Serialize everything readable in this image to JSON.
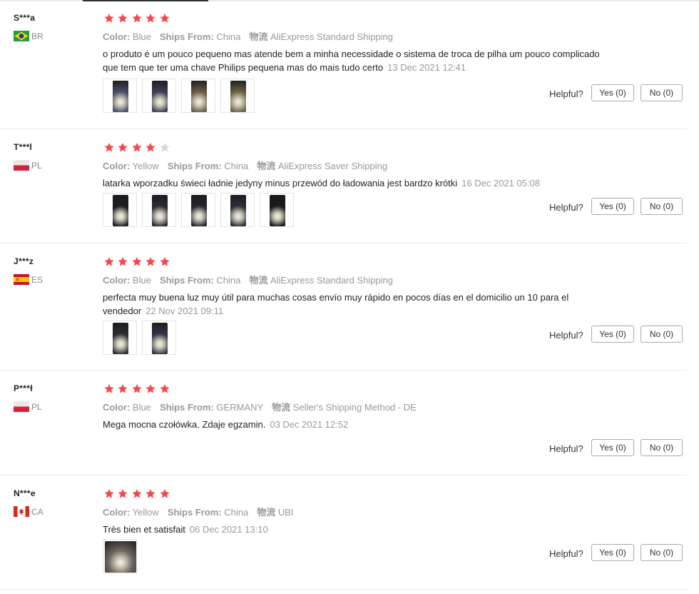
{
  "labels": {
    "color": "Color:",
    "ships_from": "Ships From:",
    "logistics": "物流",
    "helpful": "Helpful?"
  },
  "colors": {
    "star_filled": "#f5474c",
    "star_empty": "#d6d6d6",
    "label_gray": "#999999"
  },
  "reviews": [
    {
      "user": "S***a",
      "country": "BR",
      "flag_icon": "brazil-flag-icon",
      "rating": 5,
      "color": "Blue",
      "ships_from": "China",
      "shipping": "AliExpress Standard Shipping",
      "text": "o produto é um pouco pequeno mas atende bem a minha necessidade o sistema de troca de pilha um pouco complicado que tem que ter uma chave Philips pequena mas do mais tudo certo",
      "date": "13 Dec 2021 12:41",
      "photos": 4,
      "yes": "Yes (0)",
      "no": "No (0)"
    },
    {
      "user": "T***l",
      "country": "PL",
      "flag_icon": "poland-flag-icon",
      "rating": 4,
      "color": "Yellow",
      "ships_from": "China",
      "shipping": "AliExpress Saver Shipping",
      "text": "latarka wporzadku świeci ładnie jedyny minus przewód do ładowania jest bardzo krótki",
      "date": "16 Dec 2021 05:08",
      "photos": 5,
      "yes": "Yes (0)",
      "no": "No (0)"
    },
    {
      "user": "J***z",
      "country": "ES",
      "flag_icon": "spain-flag-icon",
      "rating": 5,
      "color": "Blue",
      "ships_from": "China",
      "shipping": "AliExpress Standard Shipping",
      "text": "perfecta muy buena luz muy útil para muchas cosas envío muy rápido en pocos días en el domicilio un 10 para el vendedor",
      "date": "22 Nov 2021 09:11",
      "photos": 2,
      "yes": "Yes (0)",
      "no": "No (0)"
    },
    {
      "user": "P***ł",
      "country": "PL",
      "flag_icon": "poland-flag-icon",
      "rating": 5,
      "color": "Blue",
      "ships_from": "GERMANY",
      "shipping": "Seller's Shipping Method - DE",
      "text": "Mega mocna czołówka. Zdaje egzamin.",
      "date": "03 Dec 2021 12:52",
      "photos": 0,
      "yes": "Yes (0)",
      "no": "No (0)"
    },
    {
      "user": "N***e",
      "country": "CA",
      "flag_icon": "canada-flag-icon",
      "rating": 5,
      "color": "Yellow",
      "ships_from": "China",
      "shipping": "UBI",
      "text": "Très bien et satisfait",
      "date": "06 Dec 2021 13:10",
      "photos": 1,
      "yes": "Yes (0)",
      "no": "No (0)"
    }
  ]
}
